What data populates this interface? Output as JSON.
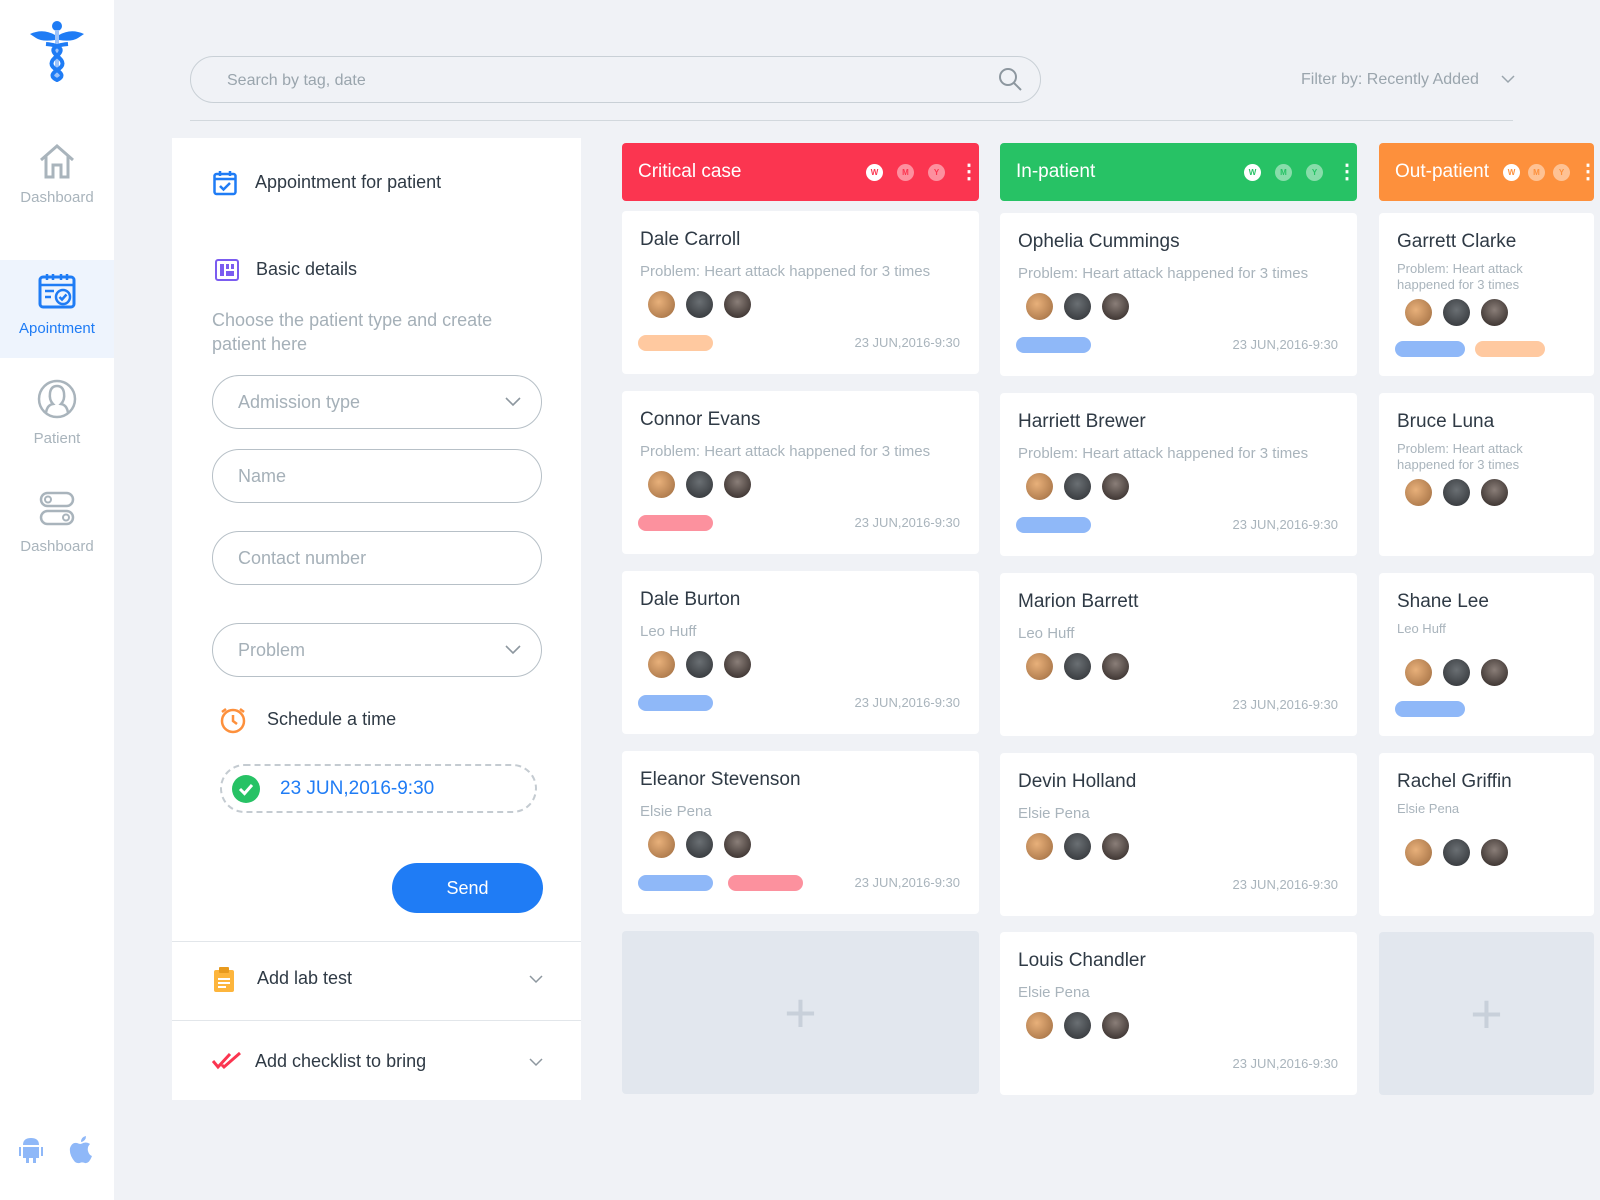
{
  "sidebar": {
    "items": [
      {
        "label": "Dashboard",
        "icon": "home-icon"
      },
      {
        "label": "Apointment",
        "icon": "calendar-icon",
        "active": true
      },
      {
        "label": "Patient",
        "icon": "user-icon"
      },
      {
        "label": "Dashboard",
        "icon": "toggle-icon"
      }
    ]
  },
  "search": {
    "placeholder": "Search by tag, date"
  },
  "filter": {
    "label": "Filter by: Recently Added"
  },
  "form": {
    "title": "Appointment for patient",
    "basic": "Basic details",
    "hint": "Choose the patient type and create patient here",
    "admission": "Admission type",
    "name": "Name",
    "contact": "Contact number",
    "problem": "Problem",
    "schedule": "Schedule a time",
    "datetime": "23 JUN,2016-9:30",
    "send": "Send",
    "lab": "Add lab test",
    "checklist": "Add checklist to bring"
  },
  "colors": {
    "accent": "#1f7cf5",
    "critical": "#fb3550",
    "inpatient": "#27c265",
    "outpatient": "#fd903c",
    "tag_orange": "#ffc9a0",
    "tag_blue": "#8fb8f8",
    "tag_pink": "#fc919e"
  },
  "header_dots": [
    "W",
    "M",
    "Y"
  ],
  "columns": [
    {
      "title": "Critical case",
      "color": "#fb3550",
      "cards": [
        {
          "name": "Dale Carroll",
          "sub": "Problem: Heart attack happened for 3 times",
          "tags": [
            "#ffc9a0"
          ],
          "date": "23 JUN,2016-9:30"
        },
        {
          "name": "Connor Evans",
          "sub": "Problem: Heart attack happened for 3 times",
          "tags": [
            "#fc919e"
          ],
          "date": "23 JUN,2016-9:30"
        },
        {
          "name": "Dale Burton",
          "sub": "Leo Huff",
          "tags": [
            "#8fb8f8"
          ],
          "date": "23 JUN,2016-9:30"
        },
        {
          "name": "Eleanor Stevenson",
          "sub": "Elsie Pena",
          "tags": [
            "#8fb8f8",
            "#fc919e"
          ],
          "date": "23 JUN,2016-9:30"
        }
      ],
      "add": true
    },
    {
      "title": "In-patient",
      "color": "#27c265",
      "cards": [
        {
          "name": "Ophelia Cummings",
          "sub": "Problem: Heart attack happened for 3 times",
          "tags": [
            "#8fb8f8"
          ],
          "date": "23 JUN,2016-9:30"
        },
        {
          "name": "Harriett Brewer",
          "sub": "Problem: Heart attack happened for 3 times",
          "tags": [
            "#8fb8f8"
          ],
          "date": "23 JUN,2016-9:30"
        },
        {
          "name": "Marion Barrett",
          "sub": "Leo Huff",
          "tags": [],
          "date": "23 JUN,2016-9:30"
        },
        {
          "name": "Devin Holland",
          "sub": "Elsie Pena",
          "tags": [],
          "date": "23 JUN,2016-9:30"
        },
        {
          "name": "Louis Chandler",
          "sub": "Elsie Pena",
          "tags": [],
          "date": "23 JUN,2016-9:30"
        }
      ],
      "add": false
    },
    {
      "title": "Out-patient",
      "color": "#fd903c",
      "cards": [
        {
          "name": "Garrett Clarke",
          "sub": "Problem: Heart attack happened for 3 times",
          "tags": [
            "#8fb8f8",
            "#ffc9a0"
          ],
          "date": ""
        },
        {
          "name": "Bruce Luna",
          "sub": "Problem: Heart attack happened for 3 times",
          "tags": [],
          "date": ""
        },
        {
          "name": "Shane Lee",
          "sub": "Leo Huff",
          "tags": [
            "#8fb8f8"
          ],
          "date": ""
        },
        {
          "name": "Rachel Griffin",
          "sub": "Elsie Pena",
          "tags": [],
          "date": ""
        }
      ],
      "add": true
    }
  ]
}
